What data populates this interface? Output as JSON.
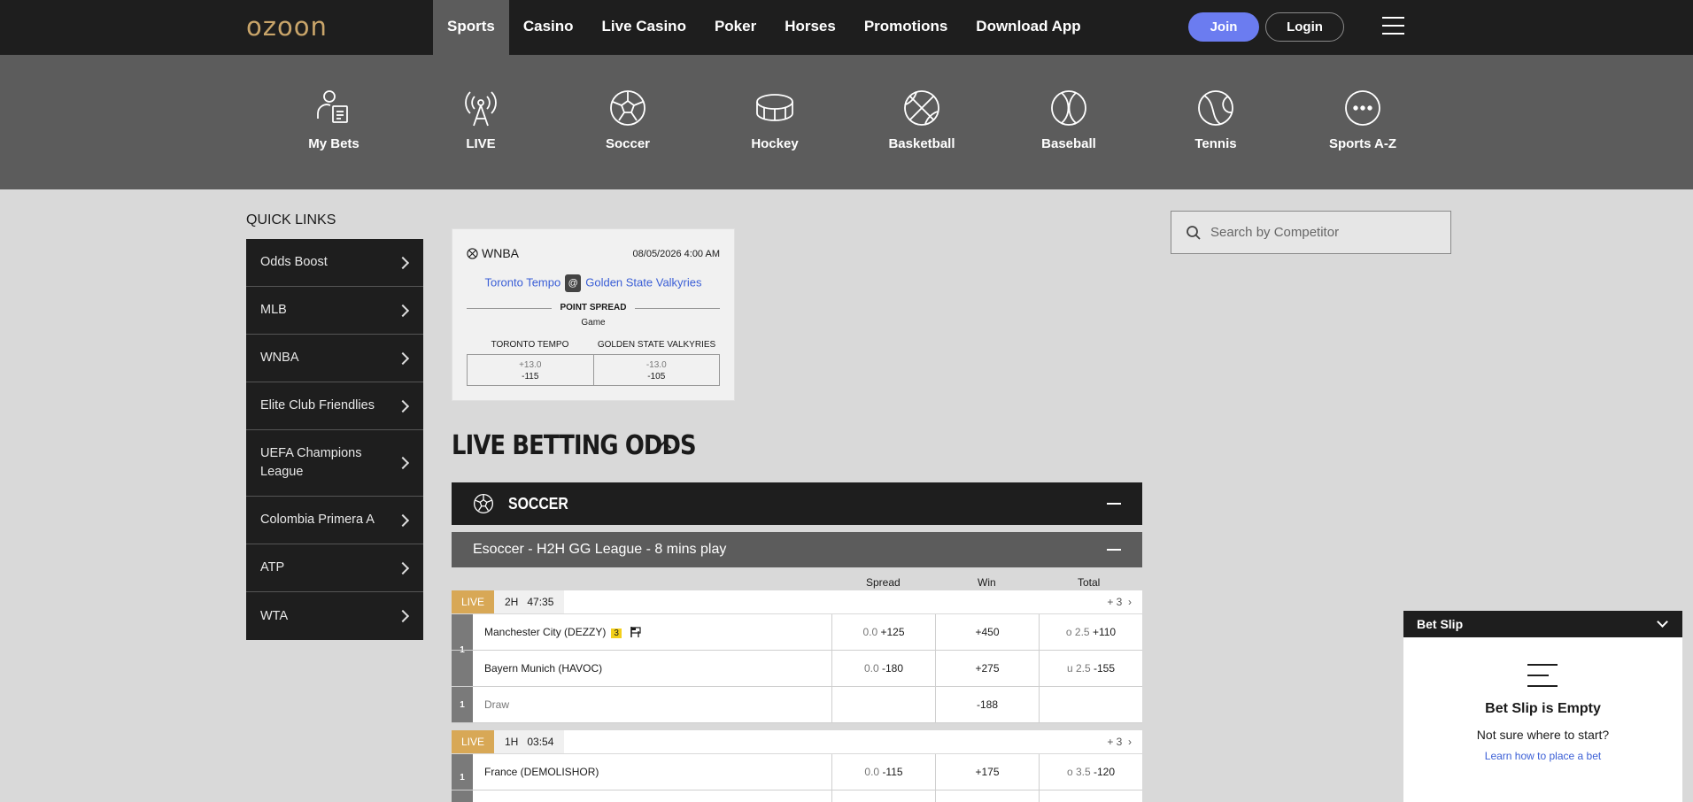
{
  "brand": {
    "logo": "OZOON",
    "accent": "#c9a56a",
    "join_color": "#6b7cf0"
  },
  "nav": {
    "items": [
      "Sports",
      "Casino",
      "Live Casino",
      "Poker",
      "Horses",
      "Promotions",
      "Download App"
    ],
    "active": "Sports",
    "join": "Join",
    "login": "Login"
  },
  "sports": [
    {
      "label": "My Bets",
      "icon": "my-bets-icon"
    },
    {
      "label": "LIVE",
      "icon": "live-antenna-icon"
    },
    {
      "label": "Soccer",
      "icon": "soccer-ball-icon"
    },
    {
      "label": "Hockey",
      "icon": "hockey-puck-icon"
    },
    {
      "label": "Basketball",
      "icon": "basketball-icon"
    },
    {
      "label": "Baseball",
      "icon": "baseball-icon"
    },
    {
      "label": "Tennis",
      "icon": "tennis-ball-icon"
    },
    {
      "label": "Sports A-Z",
      "icon": "more-dots-icon"
    }
  ],
  "quick_links": {
    "title": "QUICK LINKS",
    "items": [
      "Odds Boost",
      "MLB",
      "WNBA",
      "Elite Club Friendlies",
      "UEFA Champions League",
      "Colombia Primera A",
      "ATP",
      "WTA"
    ]
  },
  "featured": {
    "league": "WNBA",
    "date": "08/05/2026 4:00 AM",
    "home": "Toronto Tempo",
    "at": "@",
    "away": "Golden State Valkyries",
    "market": "POINT SPREAD",
    "market_sub": "Game",
    "col1": "TORONTO TEMPO",
    "col2": "GOLDEN STATE VALKYRIES",
    "odd1_line": "+13.0",
    "odd1_price": "-115",
    "odd2_line": "-13.0",
    "odd2_price": "-105"
  },
  "live": {
    "title": "LIVE BETTING ODDS",
    "sport": "SOCCER",
    "league": "Esoccer - H2H GG League - 8 mins play",
    "headers": {
      "spread": "Spread",
      "win": "Win",
      "total": "Total"
    },
    "events": [
      {
        "tag": "LIVE",
        "period": "2H",
        "clock": "47:35",
        "more": "+ 3",
        "rows": [
          {
            "num": "1",
            "team": "Manchester City (DEZZY)",
            "badge": "3",
            "spread_line": "0.0",
            "spread_price": "+125",
            "win": "+450",
            "total_prefix": "o",
            "total_line": "2.5",
            "total_price": "+110"
          },
          {
            "num": "",
            "team": "Bayern Munich (HAVOC)",
            "spread_line": "0.0",
            "spread_price": "-180",
            "win": "+275",
            "total_prefix": "u",
            "total_line": "2.5",
            "total_price": "-155"
          },
          {
            "num": "1",
            "team": "Draw",
            "win": "-188"
          }
        ]
      },
      {
        "tag": "LIVE",
        "period": "1H",
        "clock": "03:54",
        "more": "+ 3",
        "rows": [
          {
            "num": "1",
            "team": "France (DEMOLISHOR)",
            "spread_line": "0.0",
            "spread_price": "-115",
            "win": "+175",
            "total_prefix": "o",
            "total_line": "3.5",
            "total_price": "-120"
          }
        ]
      }
    ]
  },
  "search": {
    "placeholder": "Search by Competitor"
  },
  "betslip": {
    "title": "Bet Slip",
    "empty": "Bet Slip is Empty",
    "sub": "Not sure where to start?",
    "link": "Learn how to place a bet"
  }
}
